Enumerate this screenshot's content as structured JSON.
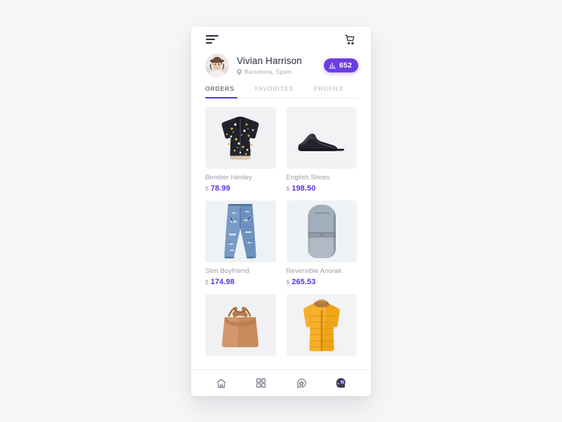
{
  "app": {
    "background_color": "#f7f7f8",
    "accent_color": "#5b32df",
    "badge_color": "#6c3de0"
  },
  "topbar": {
    "menu_icon": "hamburger-menu-icon",
    "cart_icon": "shopping-cart-icon"
  },
  "profile": {
    "avatar_icon": "user-avatar-photo",
    "name": "Vivian Harrison",
    "location": "Barcelona, Spain",
    "location_icon": "location-pin-icon",
    "badge": {
      "icon": "bar-chart-icon",
      "value": "652"
    }
  },
  "tabs": {
    "items": [
      {
        "label": "ORDERS",
        "active": true
      },
      {
        "label": "FAVORITES",
        "active": false
      },
      {
        "label": "PROFILE",
        "active": false
      }
    ]
  },
  "products": {
    "currency_symbol": "$",
    "items": [
      {
        "title": "Bomber Henley",
        "price": "78.99",
        "image": "floral-bomber-jacket-photo"
      },
      {
        "title": "English Shoes",
        "price": "198.50",
        "image": "black-leather-dress-shoe-photo"
      },
      {
        "title": "Slim Boyfriend",
        "price": "174.98",
        "image": "distressed-blue-jeans-photo"
      },
      {
        "title": "Reversible Anorak",
        "price": "265.53",
        "image": "grey-anorak-backpack-photo"
      },
      {
        "title": "",
        "price": "",
        "image": "tan-leather-bucket-bag-photo"
      },
      {
        "title": "",
        "price": "",
        "image": "yellow-puffer-coat-photo"
      }
    ]
  },
  "bottomnav": {
    "items": [
      {
        "icon": "home-icon",
        "active": false
      },
      {
        "icon": "grid-categories-icon",
        "active": false
      },
      {
        "icon": "star-badge-icon",
        "active": false
      },
      {
        "icon": "profile-head-icon",
        "active": true
      }
    ]
  }
}
